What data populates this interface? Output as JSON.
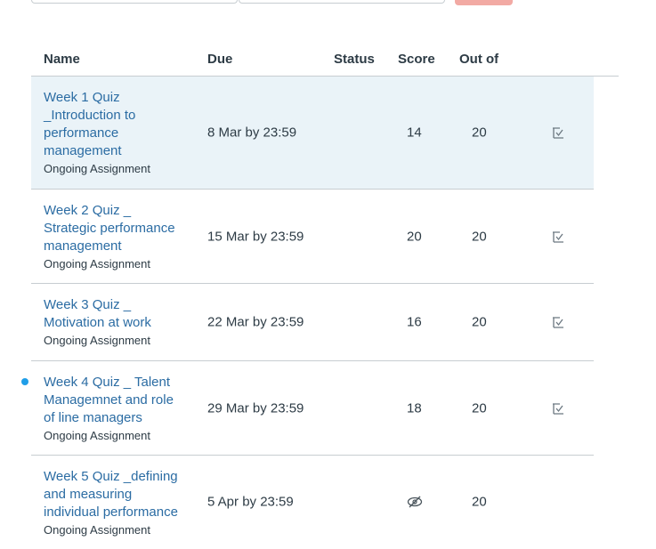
{
  "colors": {
    "link": "#2b6ca3",
    "row_highlight": "#eaf3f8",
    "unread_dot": "#1f9ee8",
    "button": "#f2aaa4"
  },
  "table": {
    "headers": {
      "name": "Name",
      "due": "Due",
      "status": "Status",
      "score": "Score",
      "out_of": "Out of"
    },
    "rows": [
      {
        "title_lines": [
          "Week 1 Quiz",
          "_Introduction to",
          "performance",
          "management"
        ],
        "subtitle": "Ongoing Assignment",
        "due": "8 Mar by 23:59",
        "status": "",
        "score": "14",
        "out_of": "20",
        "icon": "rubric-icon",
        "unread": false,
        "highlighted": true
      },
      {
        "title_lines": [
          "Week 2 Quiz _",
          "Strategic performance",
          "management"
        ],
        "subtitle": "Ongoing Assignment",
        "due": "15 Mar by 23:59",
        "status": "",
        "score": "20",
        "out_of": "20",
        "icon": "rubric-icon",
        "unread": false,
        "highlighted": false
      },
      {
        "title_lines": [
          "Week 3 Quiz _",
          "Motivation at work"
        ],
        "subtitle": "Ongoing Assignment",
        "due": "22 Mar by 23:59",
        "status": "",
        "score": "16",
        "out_of": "20",
        "icon": "rubric-icon",
        "unread": false,
        "highlighted": false
      },
      {
        "title_lines": [
          "Week 4 Quiz _ Talent",
          "Managemnet and role",
          "of line managers"
        ],
        "subtitle": "Ongoing Assignment",
        "due": "29 Mar by 23:59",
        "status": "",
        "score": "18",
        "out_of": "20",
        "icon": "rubric-icon",
        "unread": true,
        "highlighted": false
      },
      {
        "title_lines": [
          "Week 5 Quiz _defining",
          "and measuring",
          "individual performance"
        ],
        "subtitle": "Ongoing Assignment",
        "due": "5 Apr by 23:59",
        "status": "",
        "score": "",
        "score_icon": "hidden-eye-icon",
        "out_of": "20",
        "icon": "",
        "unread": false,
        "highlighted": false
      }
    ]
  }
}
